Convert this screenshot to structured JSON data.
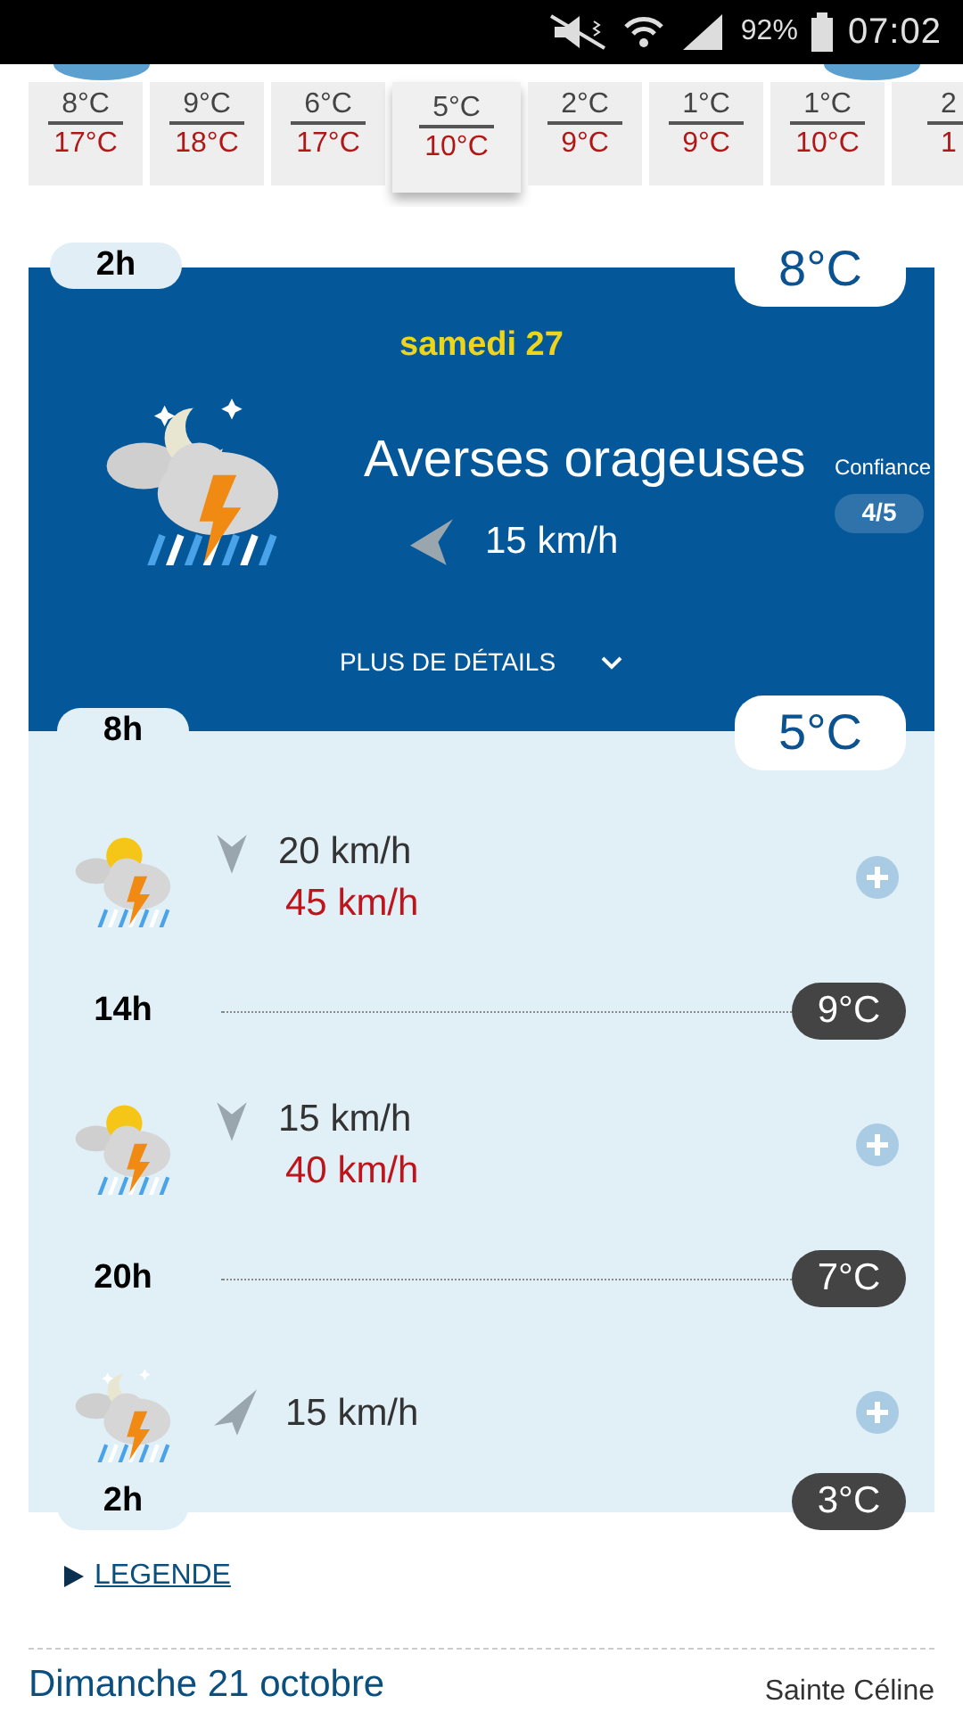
{
  "status_bar": {
    "battery": "92%",
    "time": "07:02"
  },
  "days": [
    {
      "min": "8°C",
      "max": "17°C",
      "selected": false
    },
    {
      "min": "9°C",
      "max": "18°C",
      "selected": false
    },
    {
      "min": "6°C",
      "max": "17°C",
      "selected": false
    },
    {
      "min": "5°C",
      "max": "10°C",
      "selected": true
    },
    {
      "min": "2°C",
      "max": "9°C",
      "selected": false
    },
    {
      "min": "1°C",
      "max": "9°C",
      "selected": false
    },
    {
      "min": "1°C",
      "max": "10°C",
      "selected": false
    },
    {
      "min": "2",
      "max": "1",
      "selected": false
    }
  ],
  "current": {
    "time": "2h",
    "temp": "8°C",
    "date": "samedi 27",
    "condition": "Averses orageuses",
    "wind": "15 km/h",
    "confidence_label": "Confiance",
    "confidence": "4/5",
    "details": "PLUS DE DÉTAILS"
  },
  "timeline": [
    {
      "kind": "marker",
      "time": "8h",
      "temp": "5°C"
    },
    {
      "kind": "slot",
      "wind": "20 km/h",
      "gust": "45 km/h"
    },
    {
      "kind": "marker",
      "time": "14h",
      "temp": "9°C"
    },
    {
      "kind": "slot",
      "wind": "15 km/h",
      "gust": "40 km/h"
    },
    {
      "kind": "marker",
      "time": "20h",
      "temp": "7°C"
    },
    {
      "kind": "slot",
      "wind": "15 km/h"
    },
    {
      "kind": "marker",
      "time": "2h",
      "temp": "3°C"
    }
  ],
  "legend": "LEGENDE",
  "footer": {
    "date": "Dimanche 21 octobre",
    "saint": "Sainte Céline"
  }
}
